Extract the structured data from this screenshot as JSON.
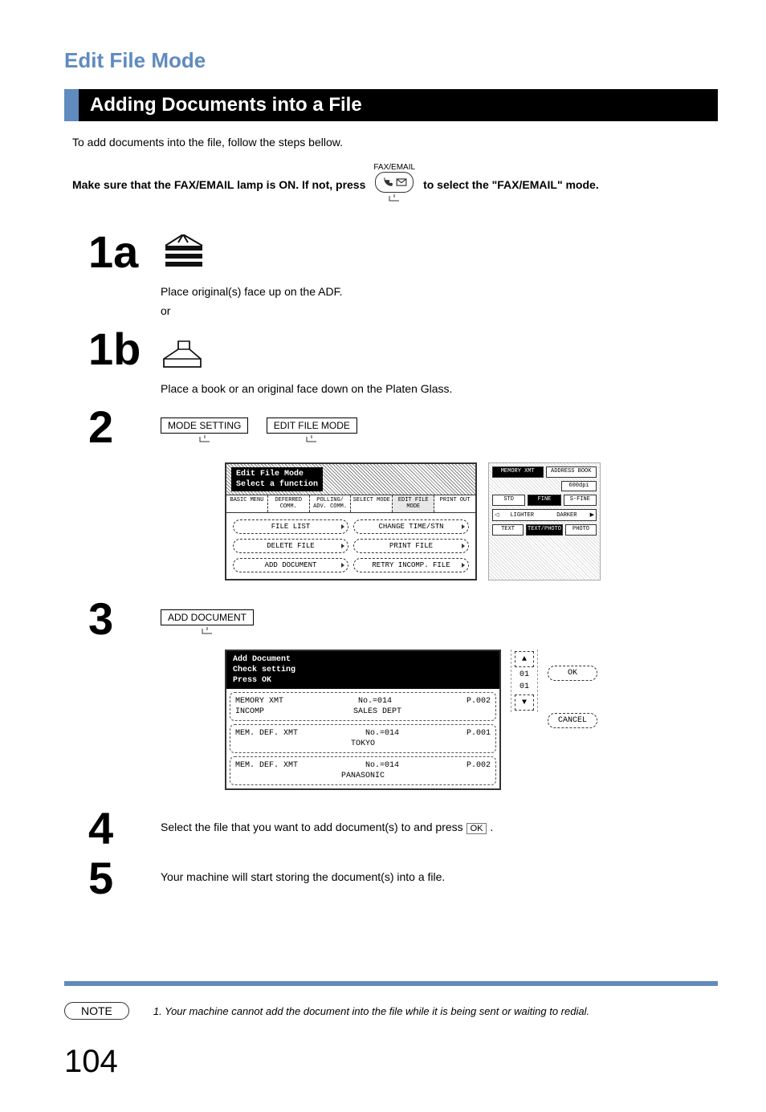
{
  "mode_title": "Edit File Mode",
  "section_header": "Adding Documents into a File",
  "intro_text": "To add documents into the file, follow the steps bellow.",
  "make_sure_prefix": "Make sure that the FAX/EMAIL lamp is ON.  If not, press",
  "make_sure_suffix": "to select the \"FAX/EMAIL\" mode.",
  "fax_email_label": "FAX/EMAIL",
  "steps": {
    "s1a_num": "1a",
    "s1a_caption": "Place original(s) face up on the ADF.",
    "s1a_or": "or",
    "s1b_num": "1b",
    "s1b_caption": "Place a book or an original face down on the Platen Glass.",
    "s2_num": "2",
    "s2_key1": "MODE SETTING",
    "s2_key2": "EDIT FILE MODE",
    "s3_num": "3",
    "s3_key": "ADD DOCUMENT",
    "s4_num": "4",
    "s4_text_a": "Select the file that you want to add document(s) to and press ",
    "s4_ok": "OK",
    "s4_text_b": ".",
    "s5_num": "5",
    "s5_text": "Your machine will start storing the document(s) into a file."
  },
  "lcd2": {
    "title_l1": "Edit File Mode",
    "title_l2": "Select a function",
    "tabs": [
      "BASIC MENU",
      "DEFERRED COMM.",
      "POLLING/ ADV. COMM.",
      "SELECT MODE",
      "EDIT FILE MODE",
      "PRINT OUT"
    ],
    "selected_tab_index": 4,
    "buttons": [
      "FILE LIST",
      "CHANGE TIME/STN",
      "DELETE FILE",
      "PRINT FILE",
      "ADD DOCUMENT",
      "RETRY INCOMP. FILE"
    ]
  },
  "side": {
    "top_status": "MEMORY XMT",
    "top_right": "ADDRESS BOOK",
    "dpi": "600dpi",
    "row1": [
      "STD",
      "FINE",
      "S-FINE"
    ],
    "brightness": [
      "LIGHTER",
      "DARKER"
    ],
    "row2": [
      "TEXT",
      "TEXT/PHOTO",
      "PHOTO"
    ]
  },
  "lcd3": {
    "hdr_l1": "Add Document",
    "hdr_l2": "Check setting",
    "hdr_l3": "Press OK",
    "rows": [
      {
        "c1": "MEMORY XMT",
        "c2": "No.=014",
        "c3": "P.002",
        "c4": "INCOMP",
        "c5": "SALES DEPT"
      },
      {
        "c1": "MEM. DEF. XMT",
        "c2": "No.=014",
        "c3": "P.001",
        "c4": "",
        "c5": "TOKYO"
      },
      {
        "c1": "MEM. DEF. XMT",
        "c2": "No.=014",
        "c3": "P.002",
        "c4": "",
        "c5": "PANASONIC"
      }
    ],
    "scroll_top": "01",
    "scroll_bot": "01",
    "ok": "OK",
    "cancel": "CANCEL"
  },
  "note": {
    "label": "NOTE",
    "text": "1. Your machine cannot add the document into the file while it is being sent or waiting to redial."
  },
  "page_number": "104"
}
